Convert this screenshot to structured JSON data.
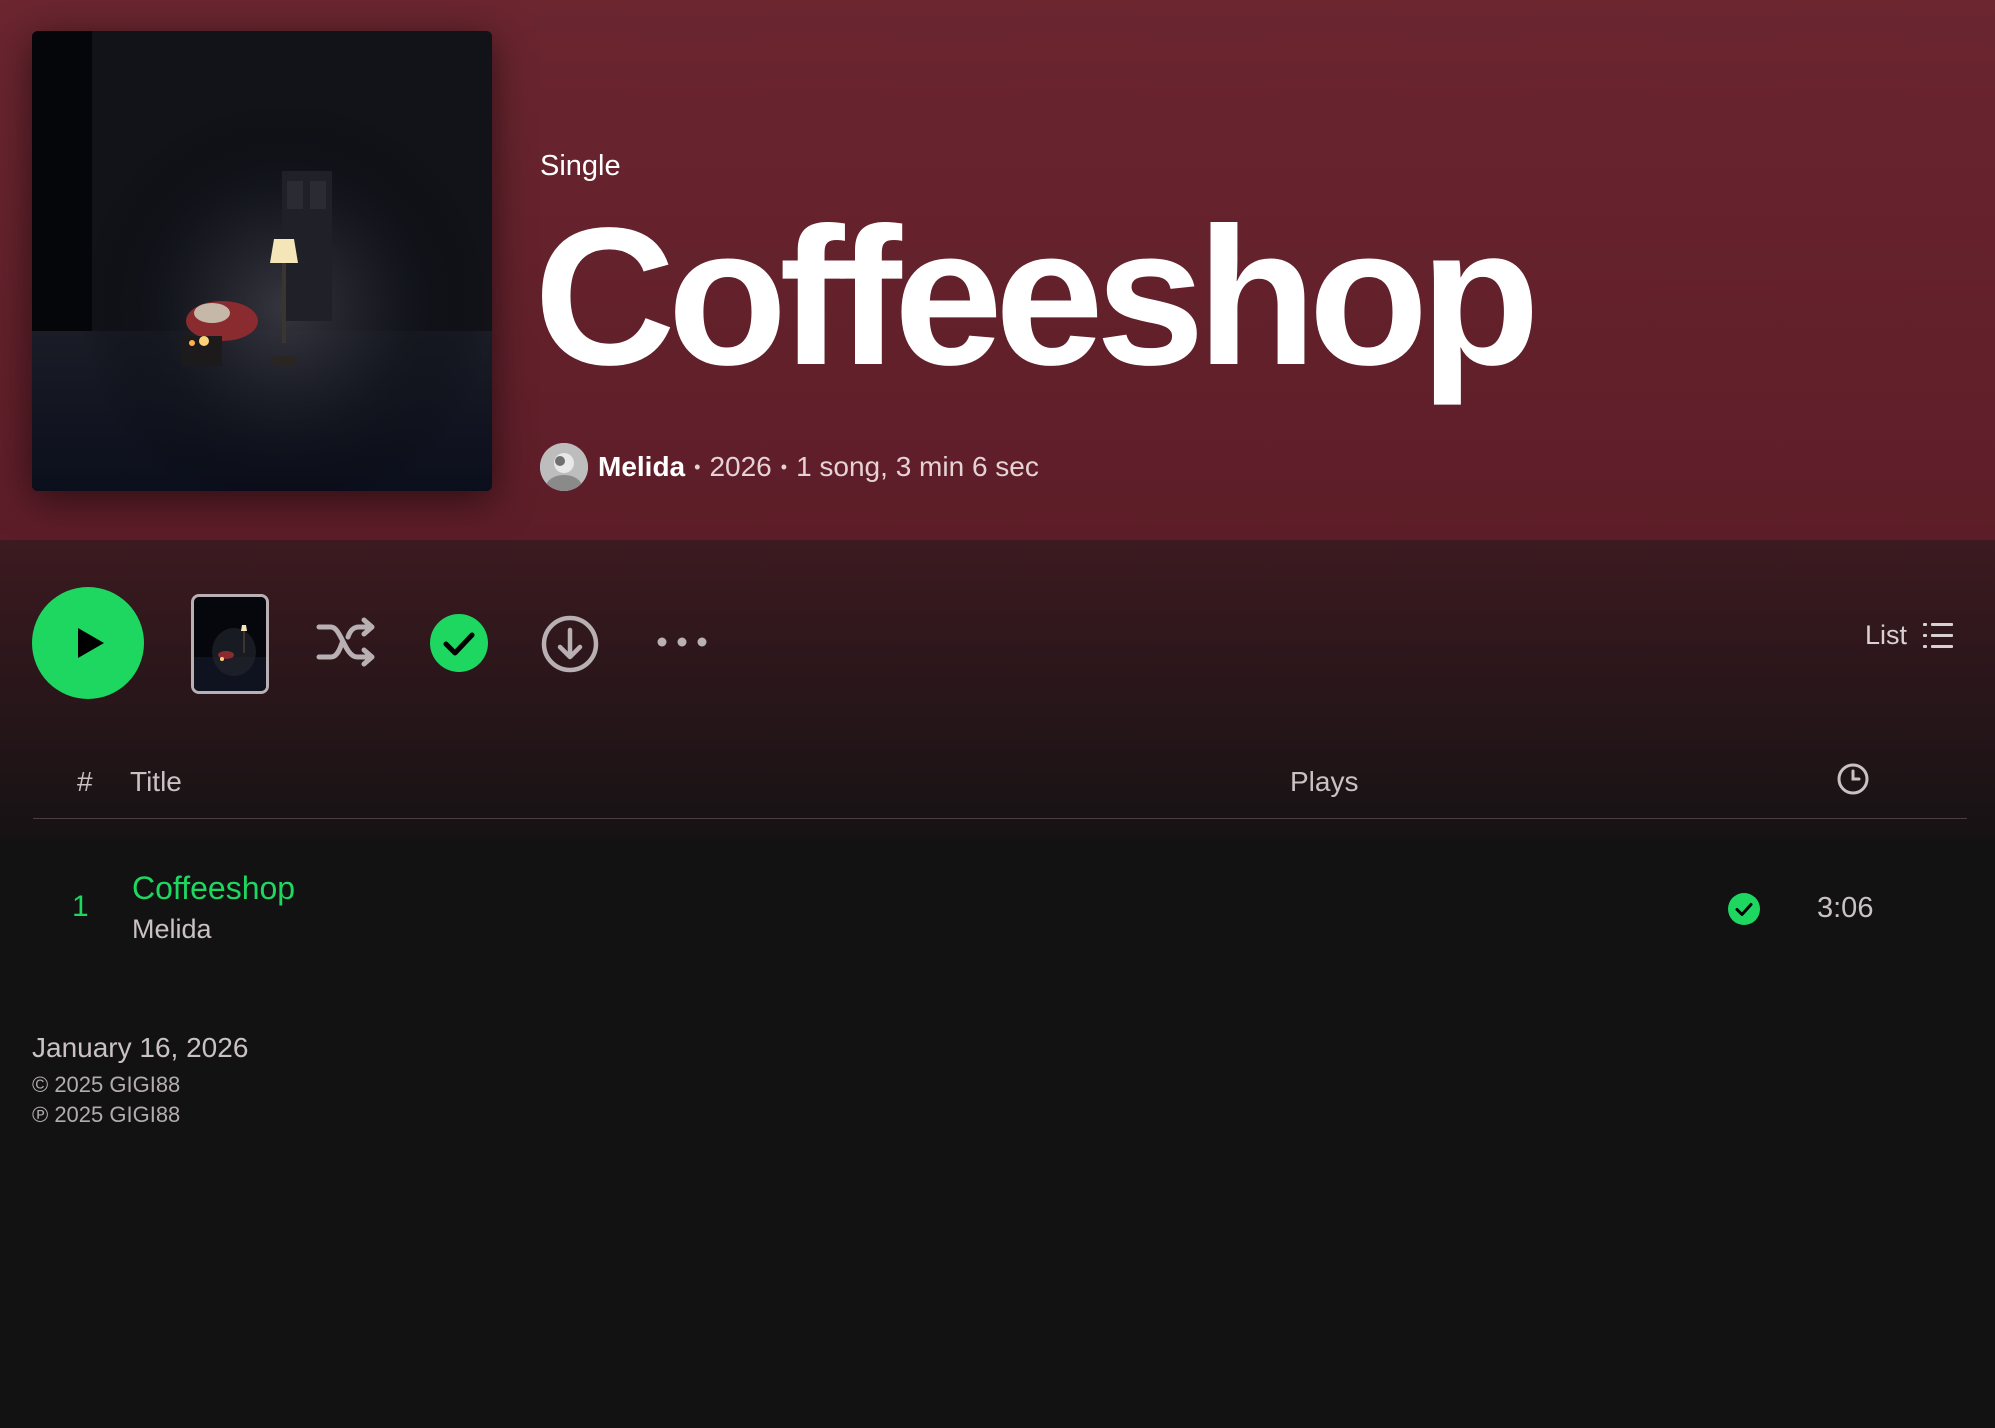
{
  "album": {
    "type_label": "Single",
    "title": "Coffeeshop",
    "artist": "Melida",
    "year": "2026",
    "summary": "1 song, 3 min 6 sec",
    "separator": "•"
  },
  "controls": {
    "list_label": "List",
    "icons": [
      "play-icon",
      "shuffle-icon",
      "check-icon",
      "download-icon",
      "more-icon",
      "list-icon"
    ]
  },
  "table": {
    "headers": {
      "num": "#",
      "title": "Title",
      "plays": "Plays",
      "duration_icon": "clock-icon"
    },
    "tracks": [
      {
        "num": "1",
        "title": "Coffeeshop",
        "artist": "Melida",
        "duration": "3:06"
      }
    ]
  },
  "release": {
    "date": "January 16, 2026",
    "copyright": "© 2025 GIGI88",
    "phonogram": "℗ 2025 GIGI88"
  },
  "colors": {
    "accent": "#1ed760",
    "hero": "#6b2630",
    "background": "#121212"
  }
}
